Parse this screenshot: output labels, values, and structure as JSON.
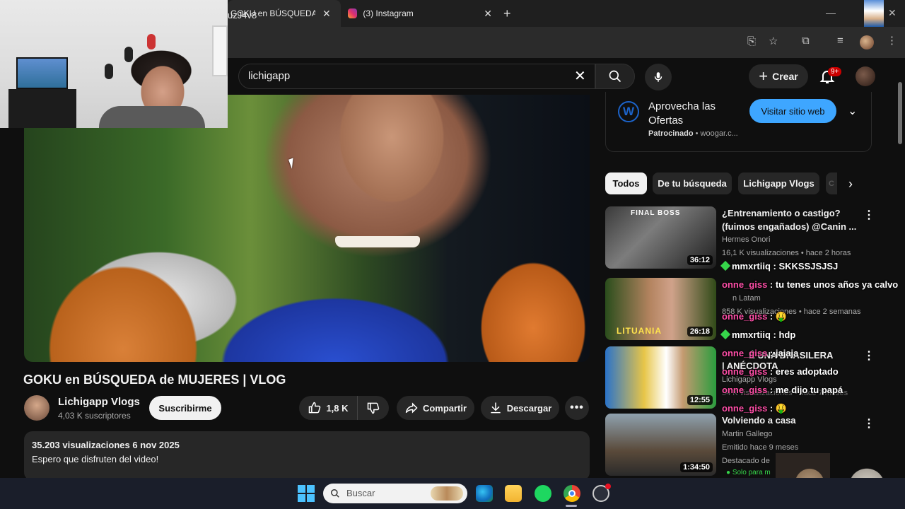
{
  "browser": {
    "tabs": [
      {
        "title": "GOKU en BÚSQUEDA de MUJERES | VLOG - YouTube",
        "active": true
      },
      {
        "title": "(3) Instagram",
        "active": false
      }
    ],
    "url": "uzJ4v8"
  },
  "header": {
    "search_value": "lichigapp",
    "create_label": "Crear",
    "notifications_badge": "9+"
  },
  "video": {
    "title": "GOKU en BÚSQUEDA de MUJERES | VLOG",
    "channel": "Lichigapp Vlogs",
    "subscribers": "4,03 K suscriptores",
    "subscribe_label": "Suscribirme",
    "likes": "1,8 K",
    "share_label": "Compartir",
    "download_label": "Descargar",
    "views_date": "35.203 visualizaciones  6 nov 2025",
    "description": "Espero que disfruten del video!"
  },
  "ad": {
    "title": "Aprovecha las Ofertas",
    "sponsored": "Patrocinado",
    "domain": "woogar.c...",
    "cta": "Visitar sitio web",
    "logo_letter": "W"
  },
  "chips": [
    "Todos",
    "De tu búsqueda",
    "Lichigapp Vlogs",
    "C"
  ],
  "related": [
    {
      "title": "¿Entrenamiento o castigo? (fuimos engañados)  @Canin ...",
      "channel": "Hermes Onori",
      "meta": "16,1 K visualizaciones • hace 2 horas",
      "duration": "36:12",
      "thumb_text": "FINAL BOSS"
    },
    {
      "title": "",
      "channel": "n Latam",
      "meta": "858 K visualizaciones • hace 2 semanas",
      "duration": "26:18",
      "thumb_text": "LITUANIA"
    },
    {
      "title": "| ANÉCDOTA",
      "channel": "Lichigapp Vlogs",
      "meta": "54 K visualizaciones • hace 7 meses",
      "duration": "12:55",
      "thumb_text": ""
    },
    {
      "title": "Volviendo a casa",
      "channel": "Martin Gallego",
      "meta": "Emitido hace 9 meses",
      "meta2": "Destacado de",
      "meta3": "Solo para m",
      "duration": "1:34:50",
      "thumb_text": ""
    }
  ],
  "chat": [
    {
      "user": "mmxrtiiq",
      "msg": " : SKKSSJSJSJ"
    },
    {
      "user": "onne_giss",
      "msg": " : tu tenes unos años ya calvo"
    },
    {
      "user": "onne_giss",
      "msg": " : 🤑"
    },
    {
      "user": "mmxrtiiq",
      "msg": " : hdp"
    },
    {
      "user": "onne_giss",
      "msg": " : jajaja"
    },
    {
      "user": "onne_giss",
      "msg": " : eres adoptado"
    },
    {
      "user": "onne_giss",
      "msg": " : me dijo tu papá"
    },
    {
      "user": "onne_giss",
      "msg": " : 🤑"
    }
  ],
  "overlap_text": {
    "brasilera": "É UNA BRASILERA"
  },
  "taskbar": {
    "search_placeholder": "Buscar"
  },
  "colors": {
    "accent_blue": "#3ea6ff",
    "youtube_red": "#cc0000",
    "chat_pink": "#ff4fa8",
    "chat_green": "#36d54a"
  }
}
